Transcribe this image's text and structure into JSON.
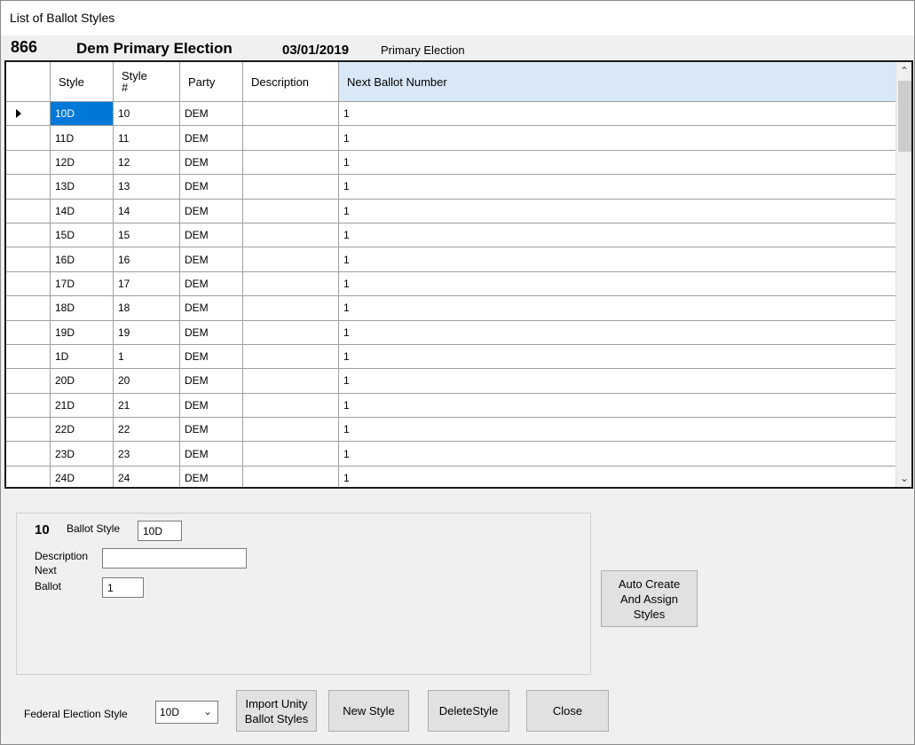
{
  "window": {
    "title": "List of Ballot Styles"
  },
  "election": {
    "number": "866",
    "name": "Dem Primary Election",
    "date": "03/01/2019",
    "type": "Primary Election"
  },
  "grid": {
    "columns": [
      "Style",
      "Style #",
      "Party",
      "Description",
      "Next Ballot Number"
    ],
    "rows": [
      {
        "style": "10D",
        "num": "10",
        "party": "DEM",
        "desc": "",
        "next": "1"
      },
      {
        "style": "11D",
        "num": "11",
        "party": "DEM",
        "desc": "",
        "next": "1"
      },
      {
        "style": "12D",
        "num": "12",
        "party": "DEM",
        "desc": "",
        "next": "1"
      },
      {
        "style": "13D",
        "num": "13",
        "party": "DEM",
        "desc": "",
        "next": "1"
      },
      {
        "style": "14D",
        "num": "14",
        "party": "DEM",
        "desc": "",
        "next": "1"
      },
      {
        "style": "15D",
        "num": "15",
        "party": "DEM",
        "desc": "",
        "next": "1"
      },
      {
        "style": "16D",
        "num": "16",
        "party": "DEM",
        "desc": "",
        "next": "1"
      },
      {
        "style": "17D",
        "num": "17",
        "party": "DEM",
        "desc": "",
        "next": "1"
      },
      {
        "style": "18D",
        "num": "18",
        "party": "DEM",
        "desc": "",
        "next": "1"
      },
      {
        "style": "19D",
        "num": "19",
        "party": "DEM",
        "desc": "",
        "next": "1"
      },
      {
        "style": "1D",
        "num": "1",
        "party": "DEM",
        "desc": "",
        "next": "1"
      },
      {
        "style": "20D",
        "num": "20",
        "party": "DEM",
        "desc": "",
        "next": "1"
      },
      {
        "style": "21D",
        "num": "21",
        "party": "DEM",
        "desc": "",
        "next": "1"
      },
      {
        "style": "22D",
        "num": "22",
        "party": "DEM",
        "desc": "",
        "next": "1"
      },
      {
        "style": "23D",
        "num": "23",
        "party": "DEM",
        "desc": "",
        "next": "1"
      },
      {
        "style": "24D",
        "num": "24",
        "party": "DEM",
        "desc": "",
        "next": "1"
      }
    ],
    "scroll_up_icon": "chevron-up-icon",
    "scroll_down_icon": "chevron-down-icon"
  },
  "detail": {
    "style_number": "10",
    "ballot_style_label": "Ballot Style",
    "ballot_style_value": "10D",
    "description_label": "Description",
    "description_value": "",
    "next_label": "Next",
    "ballot_label": "Ballot",
    "next_ballot_value": "1"
  },
  "buttons": {
    "auto_create": "Auto Create And Assign Styles",
    "import_unity": "Import Unity Ballot Styles",
    "new_style": "New Style",
    "delete_style": "DeleteStyle",
    "close": "Close"
  },
  "federal": {
    "label": "Federal Election Style",
    "selected": "10D"
  },
  "colors": {
    "selection": "#0078d7",
    "header_highlight": "#d9e8f7"
  }
}
